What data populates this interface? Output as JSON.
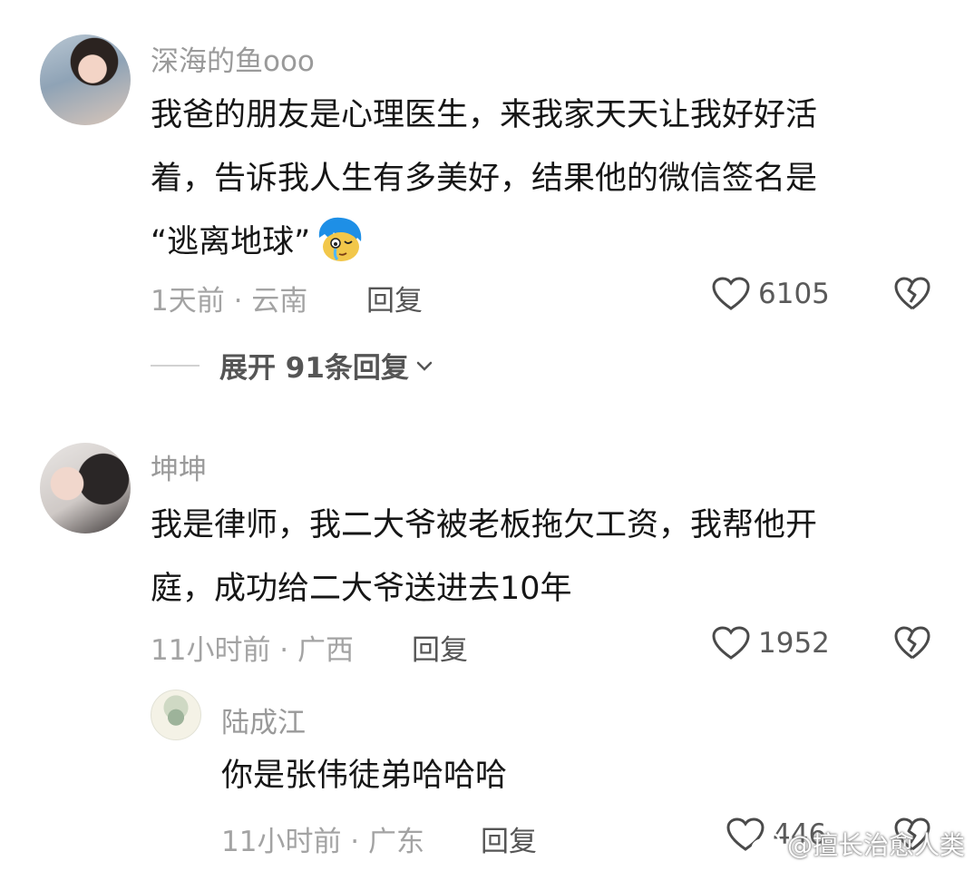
{
  "comments": [
    {
      "username": "深海的鱼ooo",
      "text_lines": [
        "我爸的朋友是心理医生，来我家天天让我好好活",
        "着，告诉我人生有多美好，结果他的微信签名是",
        "“逃离地球”"
      ],
      "emoji": "crying-blue-hair-emoji",
      "time_location": "1天前 · 云南",
      "reply_label": "回复",
      "likes": "6105",
      "expand_label": "展开 91条回复"
    },
    {
      "username": "坤坤",
      "text_lines": [
        "我是律师，我二大爷被老板拖欠工资，我帮他开",
        "庭，成功给二大爷送进去10年"
      ],
      "time_location": "11小时前 · 广西",
      "reply_label": "回复",
      "likes": "1952"
    },
    {
      "username": "陆成江",
      "text_lines": [
        "你是张伟徒弟哈哈哈"
      ],
      "time_location": "11小时前 · 广东",
      "reply_label": "回复",
      "likes": "446"
    }
  ],
  "watermark": "@擅长治愈人类",
  "icons": [
    "heart-outline-icon",
    "broken-heart-icon",
    "chevron-down-icon",
    "weibo-logo-icon"
  ],
  "colors": {
    "text": "#161616",
    "muted": "#a3a3a3",
    "username": "#9a9a9a"
  }
}
